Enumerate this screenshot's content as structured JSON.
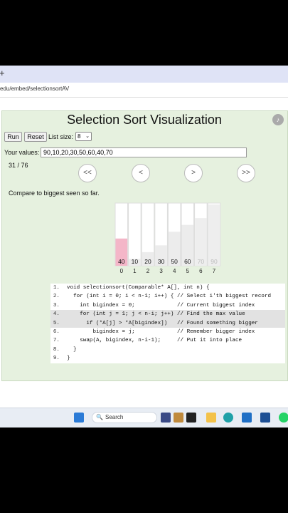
{
  "browser": {
    "new_tab_label": "+",
    "url": "edu/embed/selectionsortAV"
  },
  "app": {
    "title": "Selection Sort Visualization",
    "run_label": "Run",
    "reset_label": "Reset",
    "list_size_label": "List size:",
    "list_size_value": "8",
    "values_label": "Your values:",
    "values_input": "90,10,20,30,50,60,40,70",
    "step_counter": "31 / 76",
    "nav_first": "<<",
    "nav_prev": "<",
    "nav_next": ">",
    "nav_last": ">>",
    "message": "Compare to biggest seen so far."
  },
  "array_view": {
    "values": [
      40,
      10,
      20,
      30,
      50,
      60,
      70,
      90
    ],
    "indices": [
      "0",
      "1",
      "2",
      "3",
      "4",
      "5",
      "6",
      "7"
    ],
    "max_value": 90,
    "highlight_index": 0,
    "sorted_from_index": 6,
    "colors": {
      "highlight": "#f4b6c8",
      "normal": "#ececec",
      "sorted": "#eeeeee",
      "sorted_text": "#bbbbbb"
    }
  },
  "code": {
    "highlight_lines": [
      4,
      5
    ],
    "lines": [
      {
        "num": "1.",
        "text": "void selectionsort(Comparable* A[], int n) {"
      },
      {
        "num": "2.",
        "text": "  for (int i = 0; i < n-1; i++) { // Select i'th biggest record"
      },
      {
        "num": "3.",
        "text": "    int bigindex = 0;             // Current biggest index"
      },
      {
        "num": "4.",
        "text": "    for (int j = 1; j < n-i; j++) // Find the max value"
      },
      {
        "num": "5.",
        "text": "      if (*A[j] > *A[bigindex])   // Found something bigger"
      },
      {
        "num": "6.",
        "text": "        bigindex = j;             // Remember bigger index"
      },
      {
        "num": "7.",
        "text": "    swap(A, bigindex, n-i-1);     // Put it into place"
      },
      {
        "num": "8.",
        "text": "  }"
      },
      {
        "num": "9.",
        "text": "}"
      }
    ]
  },
  "taskbar": {
    "search_placeholder": "Search"
  }
}
